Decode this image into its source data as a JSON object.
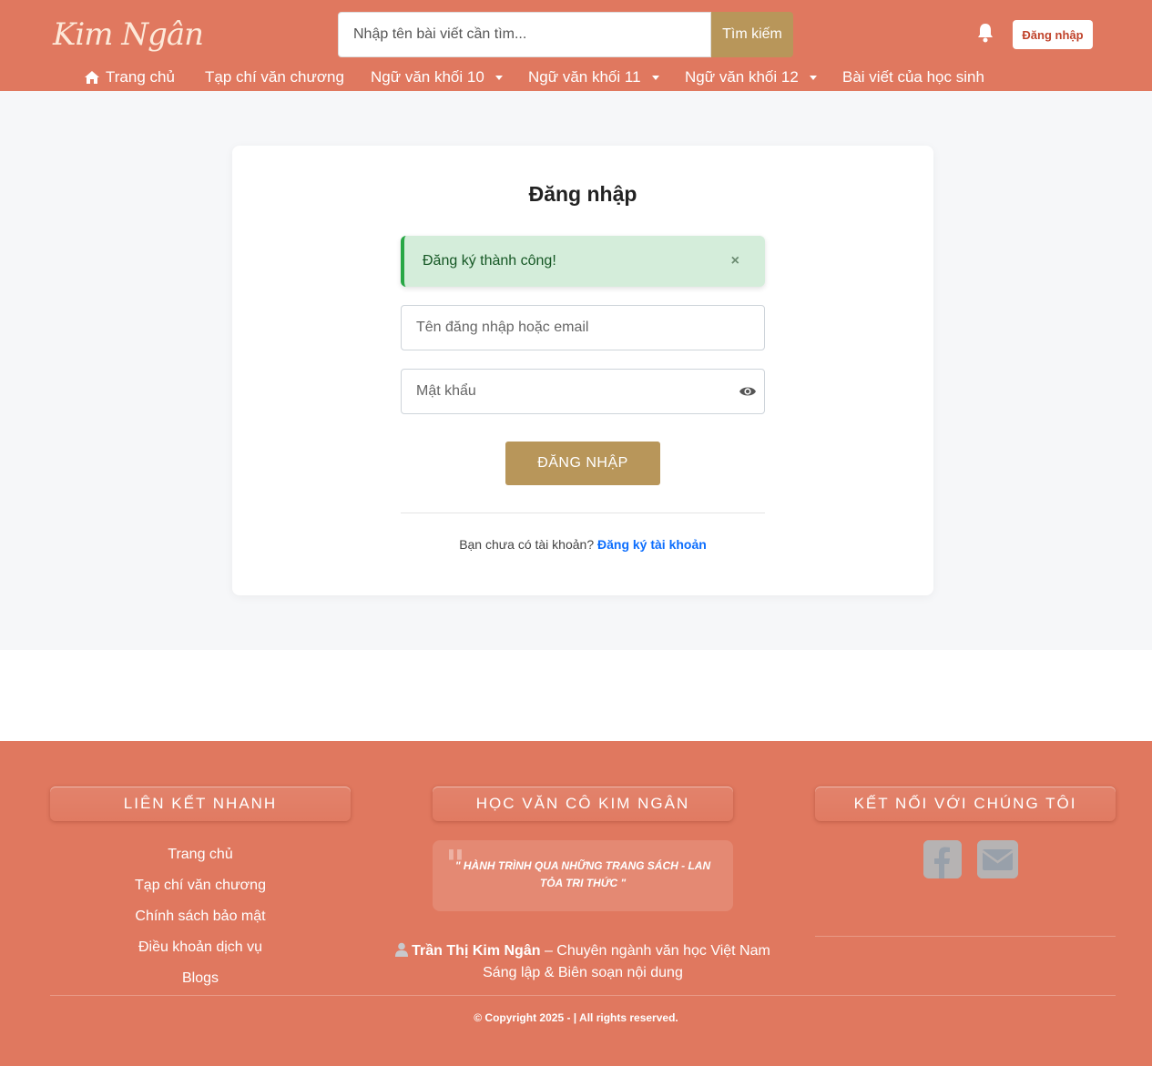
{
  "header": {
    "logo_text": "Kim Ngân",
    "search_placeholder": "Nhập tên bài viết cần tìm...",
    "search_button": "Tìm kiếm",
    "login_button": "Đăng nhập",
    "nav": [
      {
        "label": "Trang chủ",
        "icon": "home-icon"
      },
      {
        "label": "Tạp chí văn chương"
      },
      {
        "label": "Ngữ văn khối 10",
        "dropdown": true
      },
      {
        "label": "Ngữ văn khối 11",
        "dropdown": true
      },
      {
        "label": "Ngữ văn khối 12",
        "dropdown": true
      },
      {
        "label": "Bài viết của học sinh"
      }
    ]
  },
  "login_form": {
    "title": "Đăng nhập",
    "alert": {
      "text": "Đăng ký thành công!",
      "close": "×",
      "type": "success"
    },
    "username_placeholder": "Tên đăng nhập hoặc email",
    "password_placeholder": "Mật khẩu",
    "submit_label": "ĐĂNG NHẬP",
    "no_account_text": "Bạn chưa có tài khoản?",
    "register_link": "Đăng ký tài khoản"
  },
  "footer": {
    "quick_links": {
      "title": "LIÊN KẾT NHANH",
      "items": [
        "Trang chủ",
        "Tạp chí văn chương",
        "Chính sách bảo mật",
        "Điều khoản dịch vụ",
        "Blogs"
      ]
    },
    "about": {
      "title": "HỌC VĂN CÔ KIM NGÂN",
      "quote": "\" HÀNH TRÌNH QUA NHỮNG TRANG SÁCH - LAN TỎA TRI THỨC \"",
      "author_name": "Trần Thị Kim Ngân",
      "author_role": "– Chuyên ngành văn học Việt Nam",
      "author_line2": "Sáng lập & Biên soạn nội dung"
    },
    "connect": {
      "title": "KẾT NỐI VỚI CHÚNG TÔI",
      "icons": [
        "facebook-icon",
        "envelope-icon"
      ]
    },
    "copyright": "© Copyright 2025 - | All rights reserved."
  },
  "colors": {
    "primary": "#e0785f",
    "accent": "#b8965a",
    "success_bg": "#d4edda",
    "success_border": "#28a745",
    "link": "#0d6efd"
  }
}
